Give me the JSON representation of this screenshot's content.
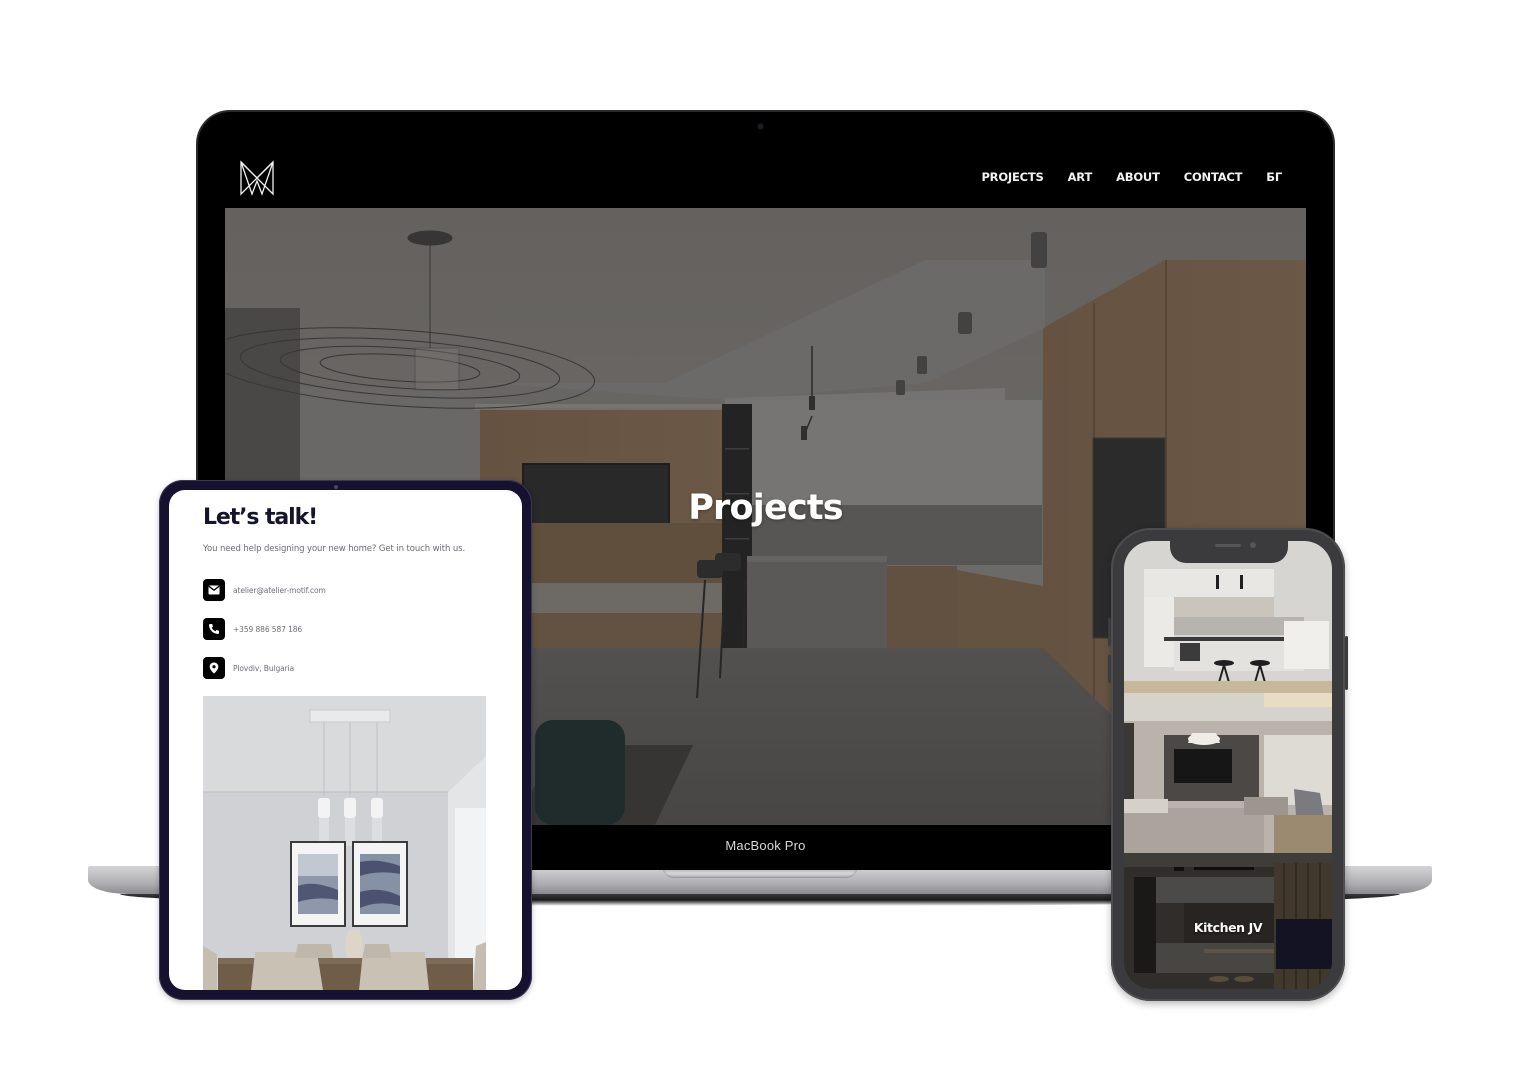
{
  "laptop": {
    "device_label": "MacBook Pro",
    "site": {
      "logo": "atelier-motif-logo",
      "nav": [
        {
          "label": "PROJECTS"
        },
        {
          "label": "ART"
        },
        {
          "label": "ABOUT"
        },
        {
          "label": "CONTACT"
        },
        {
          "label": "БГ"
        }
      ],
      "hero_title": "Projects",
      "hero_image": "kitchen-living-interior-photo"
    }
  },
  "tablet": {
    "title": "Let’s talk!",
    "subtitle": "You need help designing your new home? Get in touch with us.",
    "contacts": [
      {
        "icon": "mail-icon",
        "text": "atelier@atelier-motif.com"
      },
      {
        "icon": "phone-icon",
        "text": "+359 886 587 186"
      },
      {
        "icon": "location-pin-icon",
        "text": "Plovdiv, Bulgaria"
      }
    ],
    "image": "dining-room-photo"
  },
  "phone": {
    "images": [
      "white-kitchen-photo",
      "living-room-photo",
      "dark-kitchen-photo"
    ],
    "project_label": "Kitchen JV"
  },
  "colors": {
    "tablet_frame": "#15112e",
    "phone_frame": "#3b3b3d",
    "laptop_bezel": "#000000",
    "text_dark": "#14142b"
  }
}
